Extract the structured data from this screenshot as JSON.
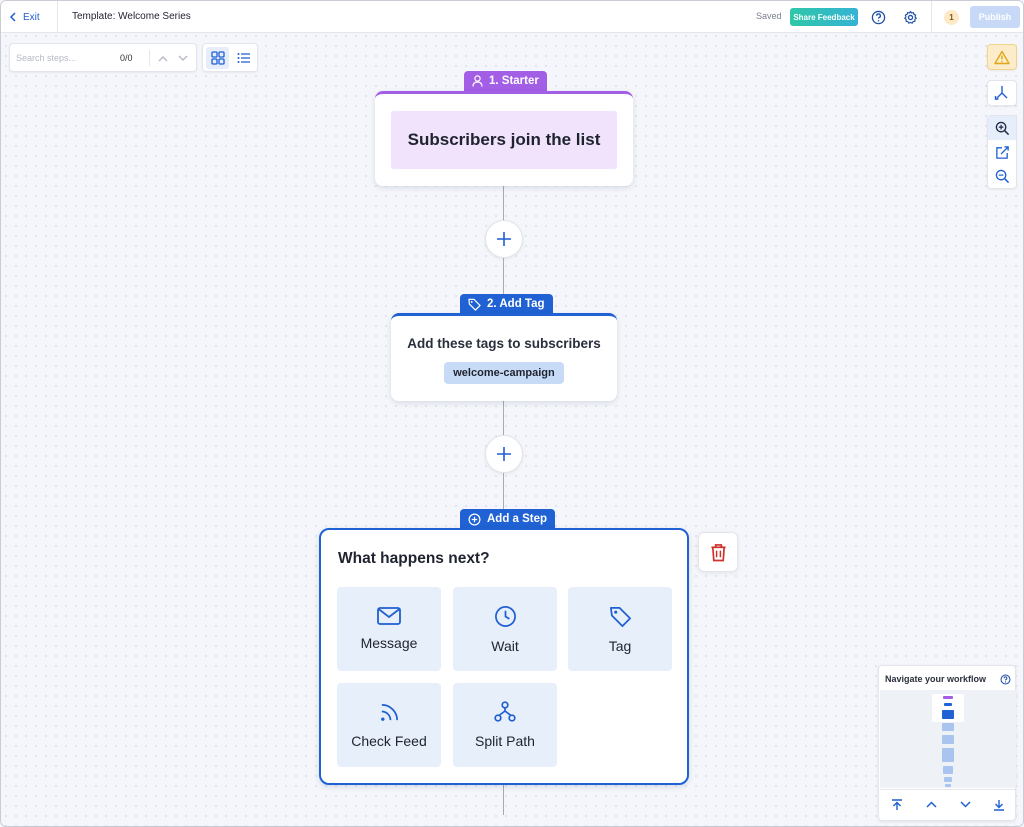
{
  "header": {
    "exit_label": "Exit",
    "title": "Template: Welcome Series",
    "saved_label": "Saved",
    "share_label": "Share Feedback",
    "notification_count": "1",
    "publish_label": "Publish"
  },
  "search": {
    "placeholder": "Search steps...",
    "count": "0/0"
  },
  "steps": {
    "starter": {
      "tag_label": "1. Starter",
      "text": "Subscribers join the list"
    },
    "add_tag": {
      "tag_label": "2. Add Tag",
      "title": "Add these tags to subscribers",
      "chip": "welcome-campaign"
    },
    "add_step": {
      "tag_label": "Add a Step",
      "title": "What happens next?",
      "options": [
        {
          "label": "Message",
          "icon": "mail-icon"
        },
        {
          "label": "Wait",
          "icon": "clock-icon"
        },
        {
          "label": "Tag",
          "icon": "tag-icon"
        },
        {
          "label": "Check Feed",
          "icon": "rss-icon"
        },
        {
          "label": "Split Path",
          "icon": "split-path-icon"
        }
      ]
    }
  },
  "minimap": {
    "title": "Navigate your workflow"
  },
  "colors": {
    "primary": "#2062d3",
    "starter": "#a35ee6",
    "warning": "#e0a51a",
    "delete": "#d0312d",
    "share_gradient_start": "#2fc7a8",
    "share_gradient_end": "#34b3d6"
  }
}
